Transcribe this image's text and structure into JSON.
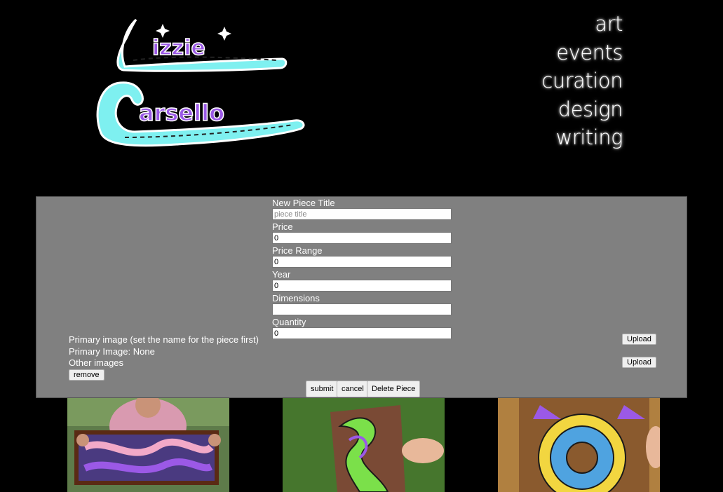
{
  "nav": {
    "items": [
      "art",
      "events",
      "curation",
      "design",
      "writing"
    ]
  },
  "logo": {
    "line1": "Lizzie",
    "line2": "Carsello"
  },
  "form": {
    "title_label": "New Piece Title",
    "title_placeholder": "piece title",
    "title_value": "",
    "price_label": "Price",
    "price_value": "0",
    "price_range_label": "Price Range",
    "price_range_value": "0",
    "year_label": "Year",
    "year_value": "0",
    "dimensions_label": "Dimensions",
    "dimensions_value": "",
    "quantity_label": "Quantity",
    "quantity_value": "0",
    "primary_image_label": "Primary image (set the name for the piece first)",
    "primary_image_status": "Primary Image: None",
    "other_images_label": "Other images",
    "upload_label": "Upload",
    "remove_label": "remove",
    "submit_label": "submit",
    "cancel_label": "cancel",
    "delete_label": "Delete Piece"
  },
  "colors": {
    "background": "#000000",
    "panel": "#808080",
    "logo_outline": "#7ef0f0",
    "logo_fill": "#9b59e6",
    "nav_text": "#ffffff"
  }
}
